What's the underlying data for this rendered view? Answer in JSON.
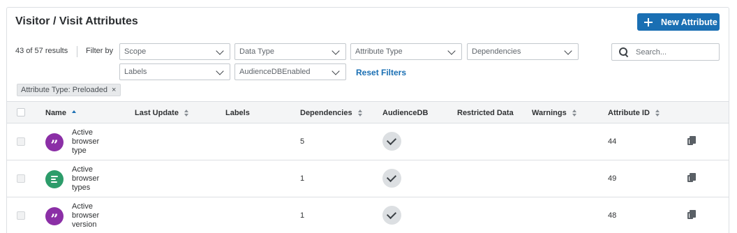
{
  "header": {
    "title": "Visitor / Visit Attributes",
    "new_button_label": "New Attribute"
  },
  "toolbar": {
    "results": "43 of 57 results",
    "filter_by": "Filter by",
    "filters": [
      "Scope",
      "Data Type",
      "Attribute Type",
      "Dependencies",
      "Labels",
      "AudienceDBEnabled"
    ],
    "reset_label": "Reset Filters",
    "search_placeholder": "Search..."
  },
  "active_filter": {
    "label": "Attribute Type: Preloaded",
    "remove": "×"
  },
  "table": {
    "columns": [
      "Name",
      "Last Update",
      "Labels",
      "Dependencies",
      "AudienceDB",
      "Restricted Data",
      "Warnings",
      "Attribute ID"
    ],
    "rows": [
      {
        "name_lines": [
          "Active",
          "browser",
          "type"
        ],
        "icon": "quote-icon",
        "dependencies": "5",
        "attribute_id": "44"
      },
      {
        "name_lines": [
          "Active",
          "browser",
          "types"
        ],
        "icon": "text-lines-icon",
        "dependencies": "1",
        "attribute_id": "49"
      },
      {
        "name_lines": [
          "Active",
          "browser",
          "version"
        ],
        "icon": "quote-icon",
        "dependencies": "1",
        "attribute_id": "48"
      }
    ]
  },
  "colors": {
    "accent": "#1a6fb3",
    "quote_icon_bg": "#8b2fa6",
    "text_icon_bg": "#2c9c6a"
  }
}
